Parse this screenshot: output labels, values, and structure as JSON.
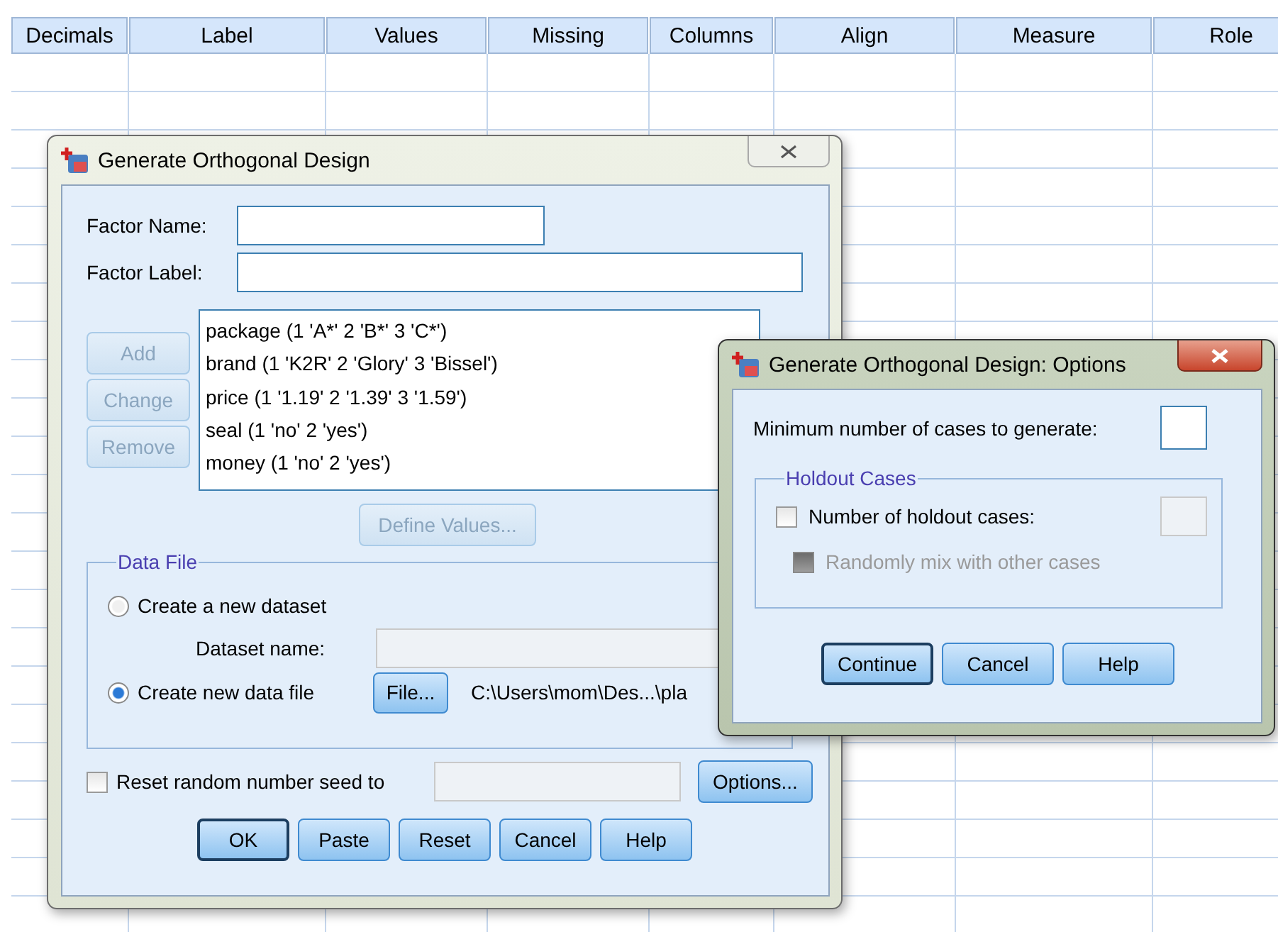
{
  "grid": {
    "columns": [
      "Decimals",
      "Label",
      "Values",
      "Missing",
      "Columns",
      "Align",
      "Measure",
      "Role"
    ]
  },
  "main_dialog": {
    "title": "Generate Orthogonal Design",
    "fields": [
      {
        "label": "Factor Name:"
      },
      {
        "label": "Factor Label:"
      }
    ],
    "side_buttons": [
      {
        "label": "Add",
        "disabled": true
      },
      {
        "label": "Change",
        "disabled": true
      },
      {
        "label": "Remove",
        "disabled": true
      }
    ],
    "factors": [
      "package (1 'A*' 2 'B*' 3 'C*')",
      "brand (1 'K2R' 2 'Glory' 3 'Bissel')",
      "price (1 '1.19' 2 '1.39' 3 '1.59')",
      "seal (1 'no' 2 'yes')",
      "money (1 'no' 2 'yes')"
    ],
    "define_values_button": {
      "label": "Define Values...",
      "disabled": true
    },
    "data_file": {
      "title": "Data File",
      "options": [
        {
          "label": "Create a new dataset",
          "selected": false
        },
        {
          "label": "Create new data file",
          "selected": true
        }
      ],
      "dataset_name_label": "Dataset name:",
      "file_button": "File...",
      "path": "C:\\Users\\mom\\Des...\\pla"
    },
    "reset_seed": {
      "label": "Reset random number seed to",
      "checked": false
    },
    "options_button": "Options...",
    "buttons": [
      {
        "label": "OK",
        "default": true
      },
      {
        "label": "Paste",
        "default": false
      },
      {
        "label": "Reset",
        "default": false
      },
      {
        "label": "Cancel",
        "default": false
      },
      {
        "label": "Help",
        "default": false
      }
    ]
  },
  "options_dialog": {
    "title": "Generate Orthogonal Design: Options",
    "min_cases_label": "Minimum number of cases to generate:",
    "holdout": {
      "title": "Holdout Cases",
      "number": {
        "label": "Number of holdout cases:",
        "checked": false
      },
      "mix": {
        "label": "Randomly mix with other cases",
        "disabled": true
      }
    },
    "buttons": [
      {
        "label": "Continue",
        "default": true
      },
      {
        "label": "Cancel",
        "default": false
      },
      {
        "label": "Help",
        "default": false
      }
    ]
  }
}
